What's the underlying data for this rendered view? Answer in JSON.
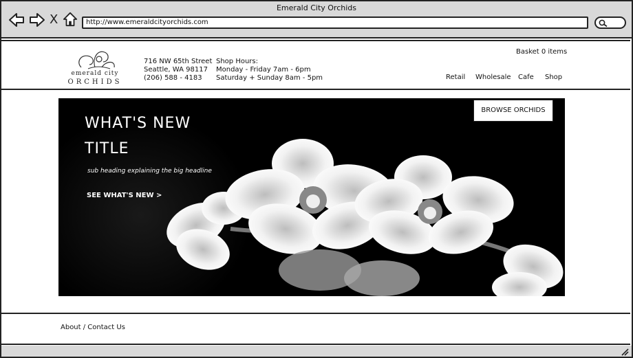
{
  "browser": {
    "window_title": "Emerald City Orchids",
    "url": "http://www.emeraldcityorchids.com",
    "close_glyph": "X",
    "icons": [
      "back-arrow-icon",
      "forward-arrow-icon",
      "close-icon",
      "home-icon",
      "search-icon",
      "resize-grip-icon"
    ]
  },
  "header": {
    "logo": {
      "word_top": "emerald city",
      "word_bottom": "ORCHIDS"
    },
    "address": [
      "716 NW 65th Street",
      "Seattle, WA 98117",
      "(206) 588 - 4183"
    ],
    "hours": [
      "Shop Hours:",
      "Monday - Friday 7am - 6pm",
      "Saturday + Sunday 8am - 5pm"
    ],
    "basket": "Basket 0 items",
    "nav": [
      "Retail",
      "Wholesale",
      "Cafe",
      "Shop"
    ]
  },
  "hero": {
    "title_line1": "WHAT'S NEW",
    "title_line2": "TITLE",
    "subheading": "sub heading explaining the big headline",
    "cta": "SEE WHAT'S NEW >",
    "browse_button": "BROWSE ORCHIDS"
  },
  "footer": {
    "link": "About / Contact Us"
  },
  "colors": {
    "chrome": "#d9d9d9",
    "outline": "#222222",
    "hero_background": "#000000",
    "text": "#111111"
  }
}
